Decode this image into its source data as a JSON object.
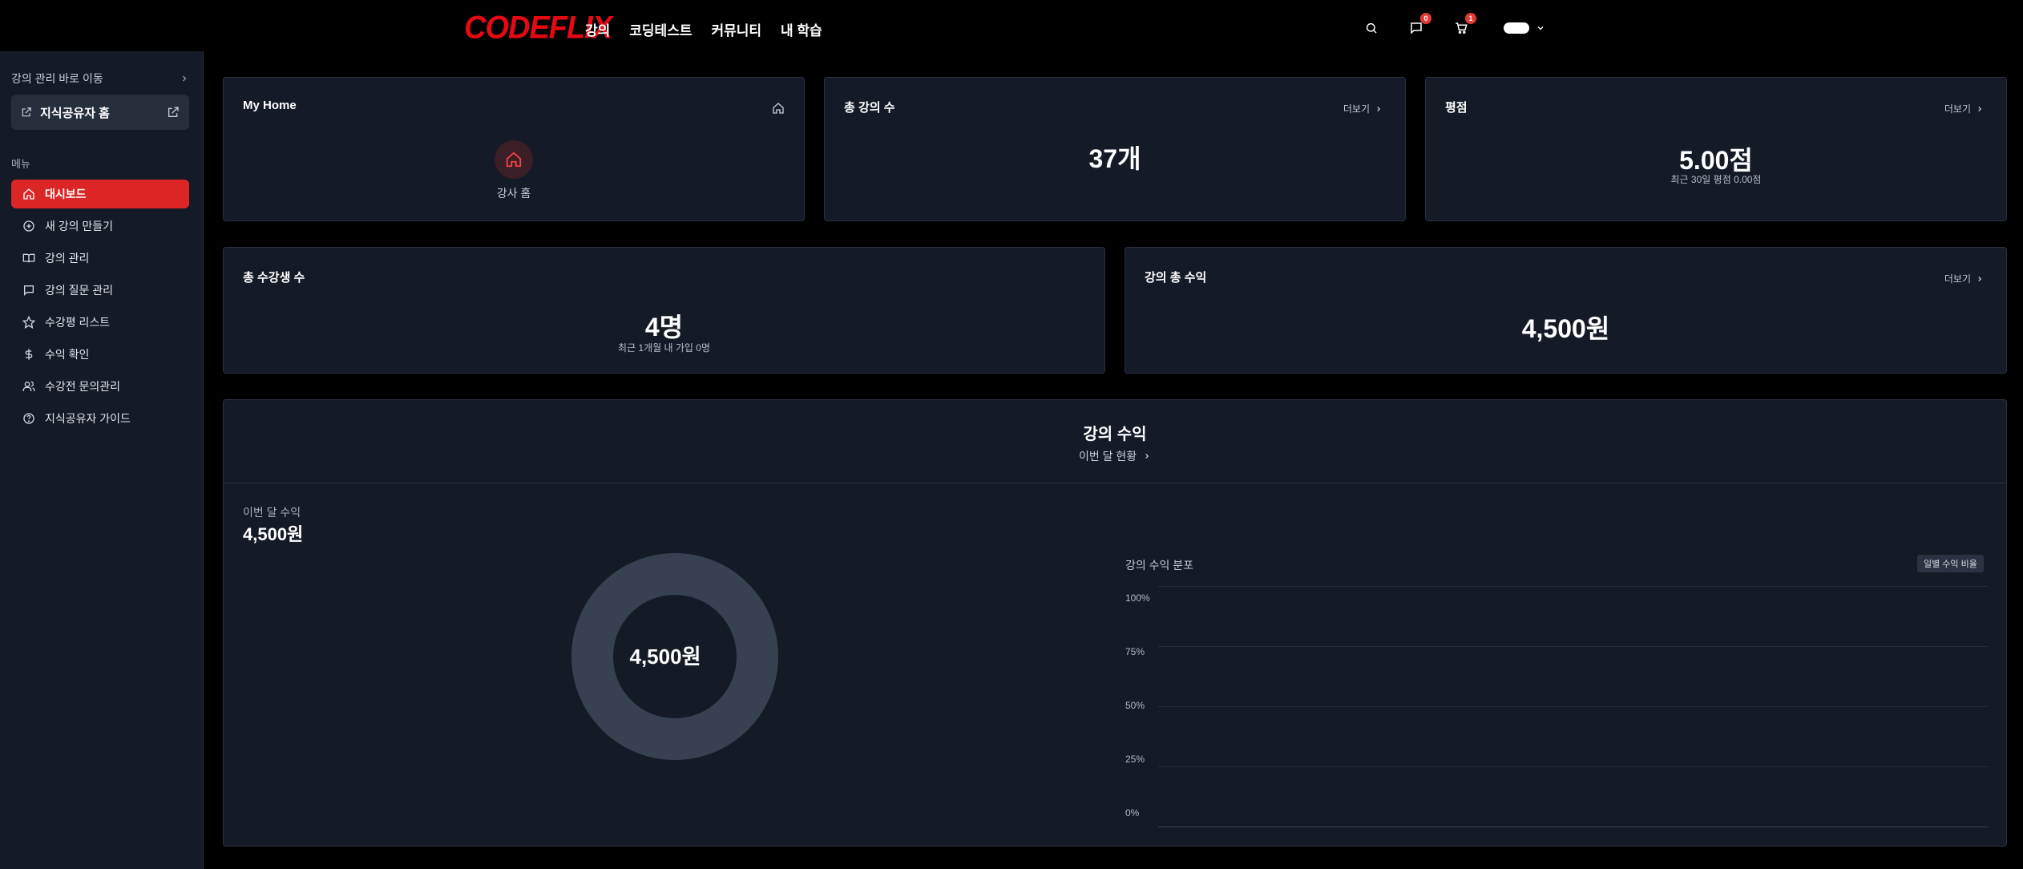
{
  "header": {
    "logo": "CODEFLIX",
    "nav": [
      "강의",
      "코딩테스트",
      "커뮤니티",
      "내 학습"
    ],
    "message_badge": "0",
    "cart_badge": "1"
  },
  "sidebar": {
    "quick_label": "강의 관리 바로 이동",
    "home_link": "지식공유자 홈",
    "menu_label": "메뉴",
    "items": [
      {
        "label": "대시보드",
        "icon": "home-icon"
      },
      {
        "label": "새 강의 만들기",
        "icon": "plus-circle-icon"
      },
      {
        "label": "강의 관리",
        "icon": "book-icon"
      },
      {
        "label": "강의 질문 관리",
        "icon": "chat-icon"
      },
      {
        "label": "수강평 리스트",
        "icon": "star-icon"
      },
      {
        "label": "수익 확인",
        "icon": "dollar-icon"
      },
      {
        "label": "수강전 문의관리",
        "icon": "users-icon"
      },
      {
        "label": "지식공유자 가이드",
        "icon": "help-icon"
      }
    ]
  },
  "cards": {
    "home": {
      "title": "My Home",
      "label": "강사 홈"
    },
    "courses": {
      "title": "총 강의 수",
      "more": "더보기",
      "value": "37개"
    },
    "rating": {
      "title": "평점",
      "more": "더보기",
      "value": "5.00점",
      "sub": "최근 30일 평점 0.00점"
    },
    "students": {
      "title": "총 수강생 수",
      "value": "4명",
      "sub": "최근 1개월 내 가입 0명"
    },
    "revenue_total": {
      "title": "강의 총 수익",
      "more": "더보기",
      "value": "4,500원"
    }
  },
  "revenue": {
    "title": "강의 수익",
    "link": "이번 달 현황",
    "month_label": "이번 달 수익",
    "month_value": "4,500원",
    "donut_center": "4,500원",
    "dist_label": "강의 수익 분포",
    "dist_button": "일별 수익 비율",
    "y_ticks": [
      "100%",
      "75%",
      "50%",
      "25%",
      "0%"
    ]
  },
  "colors": {
    "accent": "#dc2626",
    "card_bg": "#141a26",
    "donut": "#374151"
  }
}
